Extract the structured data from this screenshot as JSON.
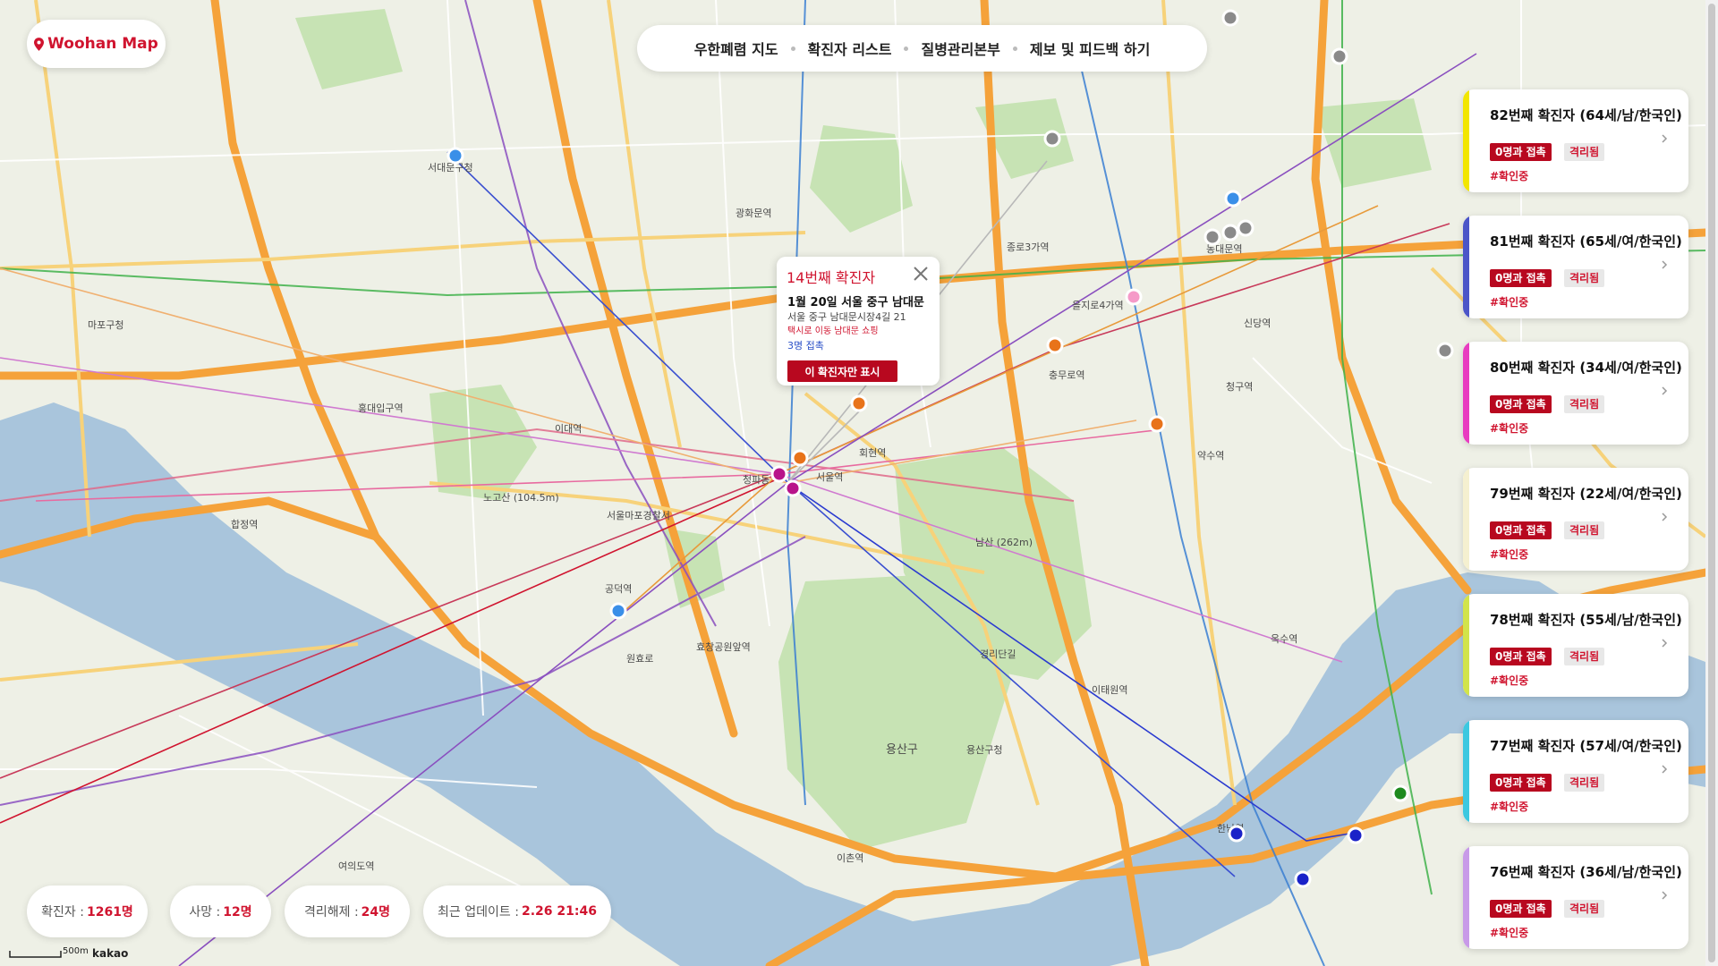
{
  "app": {
    "logo_text": "Woohan Map"
  },
  "nav": {
    "items": [
      "우한폐렴 지도",
      "확진자 리스트",
      "질병관리본부",
      "제보 및 피드백 하기"
    ]
  },
  "popup": {
    "title": "14번째 확진자",
    "date_place": "1월 20일 서울 중구 남대문",
    "address": "서울 중구 남대문시장4길 21",
    "note": "택시로 이동 남대문 쇼핑",
    "contacts": "3명 접촉",
    "button": "이 확진자만 표시"
  },
  "cards": [
    {
      "title": "82번째 확진자 (64세/남/한국인)",
      "contact": "0명과 접촉",
      "status": "격리됨",
      "tag": "#확인중",
      "color": "#f2e600"
    },
    {
      "title": "81번째 확진자 (65세/여/한국인)",
      "contact": "0명과 접촉",
      "status": "격리됨",
      "tag": "#확인중",
      "color": "#4b55c8"
    },
    {
      "title": "80번째 확진자 (34세/여/한국인)",
      "contact": "0명과 접촉",
      "status": "격리됨",
      "tag": "#확인중",
      "color": "#e83cc0"
    },
    {
      "title": "79번째 확진자 (22세/여/한국인)",
      "contact": "0명과 접촉",
      "status": "격리됨",
      "tag": "#확인중",
      "color": "#f5f0d0"
    },
    {
      "title": "78번째 확진자 (55세/남/한국인)",
      "contact": "0명과 접촉",
      "status": "격리됨",
      "tag": "#확인중",
      "color": "#d2e44a"
    },
    {
      "title": "77번째 확진자 (57세/여/한국인)",
      "contact": "0명과 접촉",
      "status": "격리됨",
      "tag": "#확인중",
      "color": "#3cc8e0"
    },
    {
      "title": "76번째 확진자 (36세/남/한국인)",
      "contact": "0명과 접촉",
      "status": "격리됨",
      "tag": "#확인중",
      "color": "#c89ae8"
    }
  ],
  "stats": {
    "confirmed_label": "확진자 :",
    "confirmed_value": "1261명",
    "deaths_label": "사망 :",
    "deaths_value": "12명",
    "released_label": "격리해제 :",
    "released_value": "24명",
    "updated_label": "최근 업데이트 :",
    "updated_value": "2.26 21:46"
  },
  "map": {
    "scale_label": "500m",
    "attribution": "kakao",
    "labels": [
      "서대문구청",
      "마포구청",
      "서울역",
      "회현역",
      "용산구청",
      "남산 (262m)",
      "용산구",
      "이촌역",
      "이태원역",
      "한남역",
      "옥수역",
      "약수역",
      "충무로역",
      "을지로4가역",
      "동대문역",
      "종로3가역",
      "광화문역",
      "공덕역",
      "합정역",
      "홍대입구역",
      "여의도역",
      "노고산 (104.5m)",
      "청구역",
      "신당역",
      "이대역",
      "서울마포경찰서",
      "경리단길",
      "청파동",
      "원효로",
      "효창공원앞역"
    ],
    "colors": {
      "water": "#a9c5dc",
      "land": "#eef0e6",
      "park": "#c7e3b4",
      "road_major": "#f5a23a",
      "road_minor": "#f7d27a"
    },
    "markers": [
      {
        "color": "#b8148a",
        "label": "14"
      }
    ]
  }
}
